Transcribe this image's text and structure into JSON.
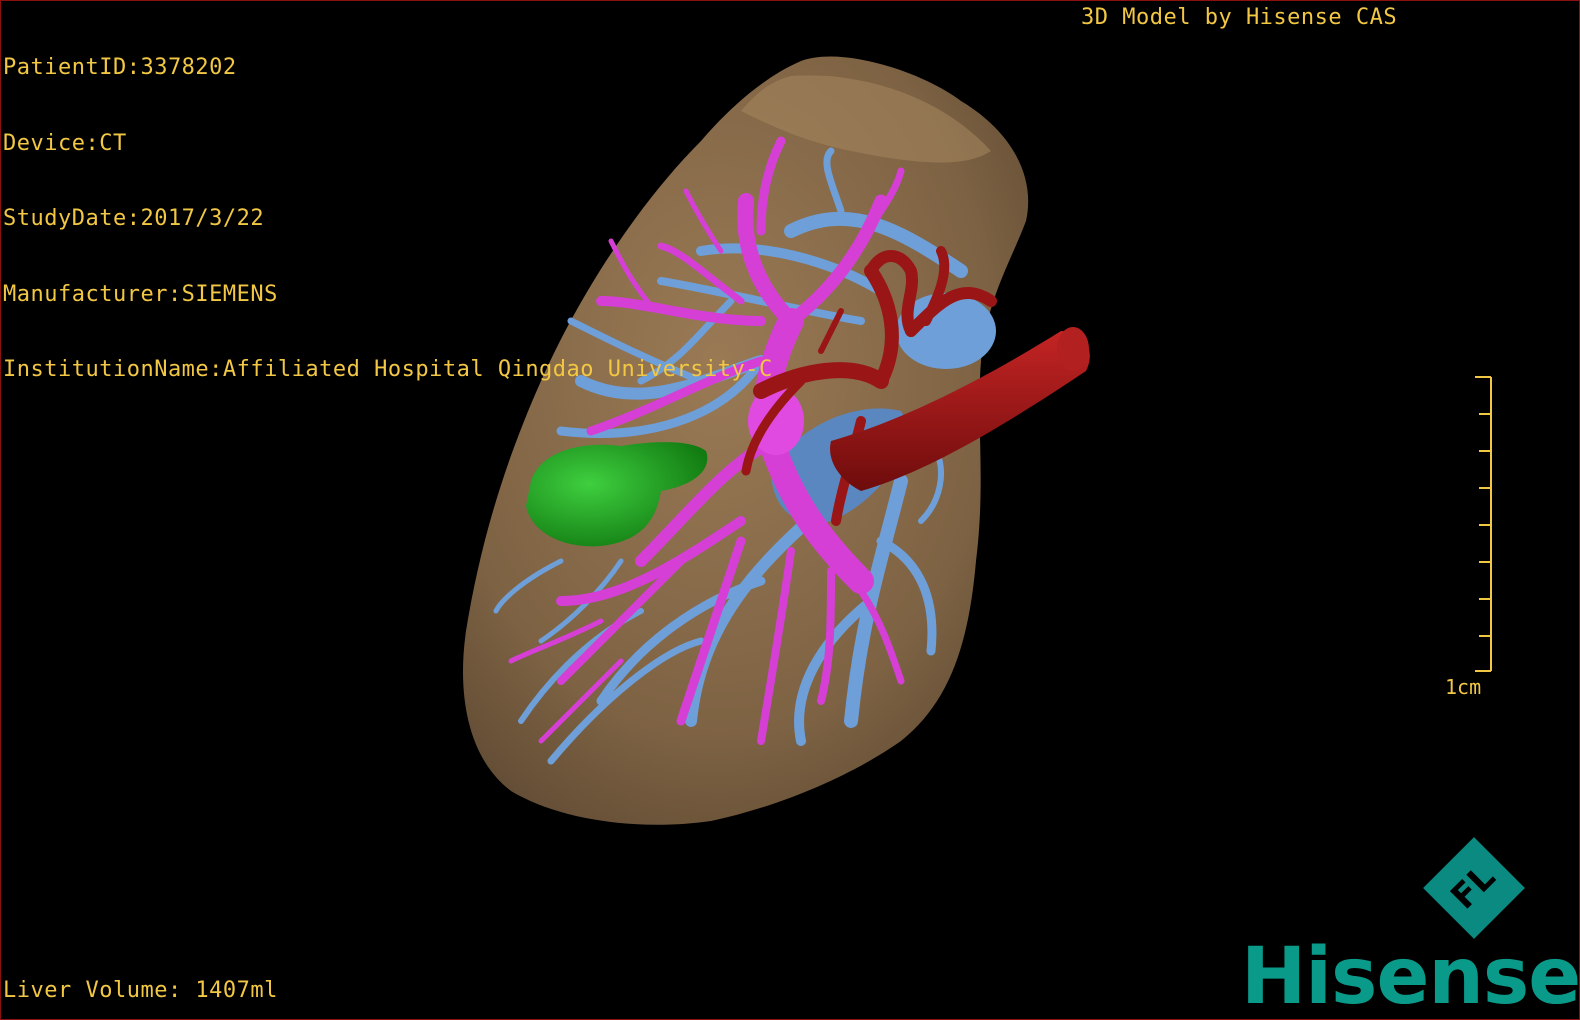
{
  "dicom": {
    "patient_id": "PatientID:3378202",
    "device": "Device:CT",
    "study_date": "StudyDate:2017/3/22",
    "manufacturer": "Manufacturer:SIEMENS",
    "institution": "InstitutionName:Affiliated Hospital Qingdao University-C"
  },
  "brand_caption": "3D Model by Hisense CAS",
  "liver_volume": "Liver Volume: 1407ml",
  "scale_bar": {
    "label": "1cm"
  },
  "logo": {
    "wordmark": "Hisense",
    "mark_letters": "FL"
  },
  "colors": {
    "overlay_text": "#f2c744",
    "liver": "#8a6c4a",
    "portal_vein": "#d63fd6",
    "hepatic_vein": "#6f9fd8",
    "artery": "#9a1616",
    "gallbladder": "#1f9a1f",
    "logo": "#0a9a8a"
  },
  "icons": [
    "liver-3d-model",
    "hisense-fl-logo-mark"
  ]
}
